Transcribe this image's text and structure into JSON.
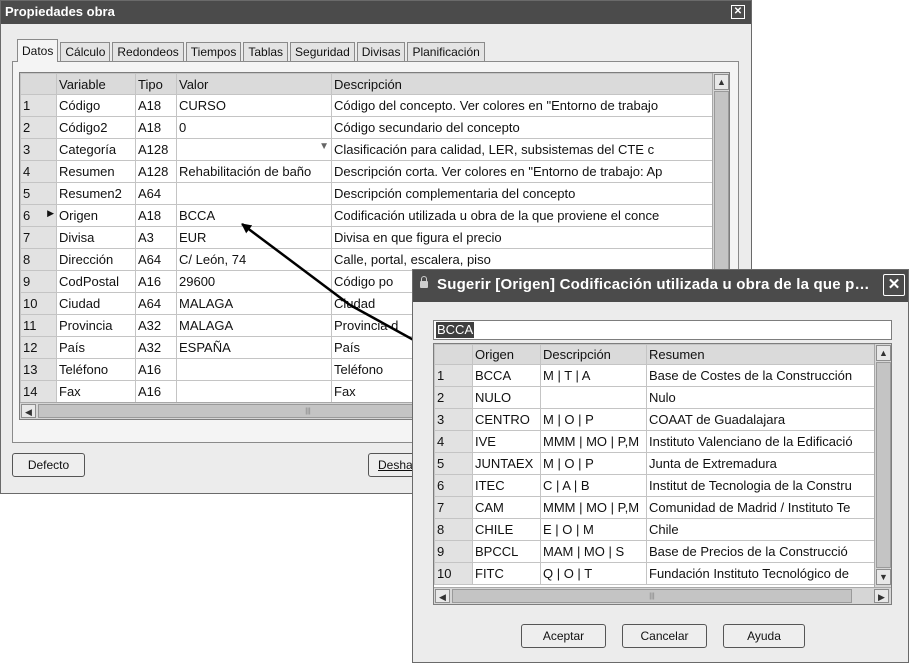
{
  "main_window": {
    "title": "Propiedades obra",
    "close_glyph": "✕",
    "tabs": [
      "Datos",
      "Cálculo",
      "Redondeos",
      "Tiempos",
      "Tablas",
      "Seguridad",
      "Divisas",
      "Planificación"
    ],
    "active_tab": "Datos",
    "columns": [
      "",
      "Variable",
      "Tipo",
      "Valor",
      "Descripción"
    ],
    "rows": [
      {
        "n": "1",
        "var": "Código",
        "tipo": "A18",
        "valor": "CURSO",
        "desc": "Código del concepto. Ver colores en \"Entorno de trabajo"
      },
      {
        "n": "2",
        "var": "Código2",
        "tipo": "A18",
        "valor": "0",
        "desc": "Código secundario del concepto"
      },
      {
        "n": "3",
        "var": "Categoría",
        "tipo": "A128",
        "valor": "",
        "desc": "Clasificación para calidad, LER, subsistemas del CTE c"
      },
      {
        "n": "4",
        "var": "Resumen",
        "tipo": "A128",
        "valor": "Rehabilitación de baño",
        "desc": "Descripción corta. Ver colores en \"Entorno de trabajo: Ap"
      },
      {
        "n": "5",
        "var": "Resumen2",
        "tipo": "A64",
        "valor": "",
        "desc": "Descripción complementaria del concepto"
      },
      {
        "n": "6",
        "var": "Origen",
        "tipo": "A18",
        "valor": "BCCA",
        "desc": "Codificación utilizada u obra de la que proviene el conce"
      },
      {
        "n": "7",
        "var": "Divisa",
        "tipo": "A3",
        "valor": "EUR",
        "desc": "Divisa en que figura el precio"
      },
      {
        "n": "8",
        "var": "Dirección",
        "tipo": "A64",
        "valor": "C/ León, 74",
        "desc": "Calle, portal, escalera, piso"
      },
      {
        "n": "9",
        "var": "CodPostal",
        "tipo": "A16",
        "valor": "29600",
        "desc": "Código po"
      },
      {
        "n": "10",
        "var": "Ciudad",
        "tipo": "A64",
        "valor": "MALAGA",
        "desc": "Ciudad"
      },
      {
        "n": "11",
        "var": "Provincia",
        "tipo": "A32",
        "valor": "MALAGA",
        "desc": "Provincia d"
      },
      {
        "n": "12",
        "var": "País",
        "tipo": "A32",
        "valor": "ESPAÑA",
        "desc": "País"
      },
      {
        "n": "13",
        "var": "Teléfono",
        "tipo": "A16",
        "valor": "",
        "desc": "Teléfono"
      },
      {
        "n": "14",
        "var": "Fax",
        "tipo": "A16",
        "valor": "",
        "desc": "Fax"
      }
    ],
    "current_row_marker": "▶",
    "dropdown_glyph": "▼",
    "button_defecto": "Defecto",
    "button_deshacer": "Desha"
  },
  "suggest_window": {
    "title": "Sugerir [Origen] Codificación utilizada u obra de la que p…",
    "close_glyph": "✕",
    "lock_glyph": "🔒",
    "search_value": "BCCA",
    "columns": [
      "",
      "Origen",
      "Descripción",
      "Resumen"
    ],
    "rows": [
      {
        "n": "1",
        "origen": "BCCA",
        "desc": "M | T | A",
        "res": "Base de Costes de la Construcción"
      },
      {
        "n": "2",
        "origen": "NULO",
        "desc": "",
        "res": "Nulo"
      },
      {
        "n": "3",
        "origen": "CENTRO",
        "desc": "M | O | P",
        "res": "COAAT de Guadalajara"
      },
      {
        "n": "4",
        "origen": "IVE",
        "desc": "MMM | MO | P,M",
        "res": "Instituto Valenciano de la Edificació"
      },
      {
        "n": "5",
        "origen": "JUNTAEX",
        "desc": "M | O | P",
        "res": "Junta de Extremadura"
      },
      {
        "n": "6",
        "origen": "ITEC",
        "desc": "C | A | B",
        "res": "Institut de Tecnologia de la Constru"
      },
      {
        "n": "7",
        "origen": "CAM",
        "desc": "MMM | MO | P,M",
        "res": "Comunidad de Madrid / Instituto Te"
      },
      {
        "n": "8",
        "origen": "CHILE",
        "desc": "E | O | M",
        "res": "Chile"
      },
      {
        "n": "9",
        "origen": "BPCCL",
        "desc": "MAM | MO | S",
        "res": "Base de Precios de la Construcció"
      },
      {
        "n": "10",
        "origen": "FITC",
        "desc": "Q | O | T",
        "res": "Fundación Instituto Tecnológico de"
      }
    ],
    "button_aceptar": "Aceptar",
    "button_cancelar": "Cancelar",
    "button_ayuda": "Ayuda"
  },
  "scroll_glyphs": {
    "up": "▲",
    "down": "▼",
    "left": "◀",
    "right": "▶",
    "grip": "|||"
  }
}
